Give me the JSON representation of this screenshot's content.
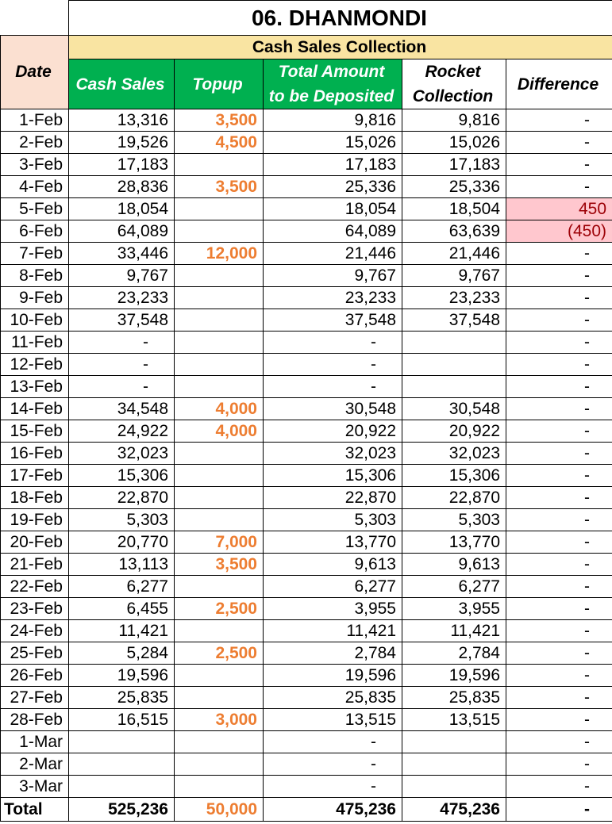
{
  "sheet": {
    "title": "06. DHANMONDI",
    "band_label": "Cash Sales Collection",
    "headers": {
      "date": "Date",
      "cash_sales": "Cash Sales",
      "topup": "Topup",
      "total_line1": "Total Amount",
      "total_line2": "to be Deposited",
      "rocket_line1": "Rocket",
      "rocket_line2": "Collection",
      "difference": "Difference"
    },
    "colors": {
      "header_green": "#00b050",
      "band_yellow": "#f9e4a2",
      "date_header_peach": "#fbe0d1",
      "topup_orange": "#ed7d31",
      "diff_highlight_bg": "#ffc7ce",
      "diff_highlight_text": "#9c0006"
    },
    "rows": [
      {
        "date": "1-Feb",
        "cash": "13,316",
        "topup": "3,500",
        "total": "9,816",
        "rocket": "9,816",
        "diff": "-"
      },
      {
        "date": "2-Feb",
        "cash": "19,526",
        "topup": "4,500",
        "total": "15,026",
        "rocket": "15,026",
        "diff": "-"
      },
      {
        "date": "3-Feb",
        "cash": "17,183",
        "topup": "",
        "total": "17,183",
        "rocket": "17,183",
        "diff": "-"
      },
      {
        "date": "4-Feb",
        "cash": "28,836",
        "topup": "3,500",
        "total": "25,336",
        "rocket": "25,336",
        "diff": "-"
      },
      {
        "date": "5-Feb",
        "cash": "18,054",
        "topup": "",
        "total": "18,054",
        "rocket": "18,504",
        "diff": "450",
        "diff_highlight": true
      },
      {
        "date": "6-Feb",
        "cash": "64,089",
        "topup": "",
        "total": "64,089",
        "rocket": "63,639",
        "diff": "(450)",
        "diff_highlight": true
      },
      {
        "date": "7-Feb",
        "cash": "33,446",
        "topup": "12,000",
        "total": "21,446",
        "rocket": "21,446",
        "diff": "-"
      },
      {
        "date": "8-Feb",
        "cash": "9,767",
        "topup": "",
        "total": "9,767",
        "rocket": "9,767",
        "diff": "-"
      },
      {
        "date": "9-Feb",
        "cash": "23,233",
        "topup": "",
        "total": "23,233",
        "rocket": "23,233",
        "diff": "-"
      },
      {
        "date": "10-Feb",
        "cash": "37,548",
        "topup": "",
        "total": "37,548",
        "rocket": "37,548",
        "diff": "-"
      },
      {
        "date": "11-Feb",
        "cash": "-",
        "topup": "",
        "total": "-",
        "rocket": "",
        "diff": "-"
      },
      {
        "date": "12-Feb",
        "cash": "-",
        "topup": "",
        "total": "-",
        "rocket": "",
        "diff": "-"
      },
      {
        "date": "13-Feb",
        "cash": "-",
        "topup": "",
        "total": "-",
        "rocket": "",
        "diff": "-"
      },
      {
        "date": "14-Feb",
        "cash": "34,548",
        "topup": "4,000",
        "total": "30,548",
        "rocket": "30,548",
        "diff": "-"
      },
      {
        "date": "15-Feb",
        "cash": "24,922",
        "topup": "4,000",
        "total": "20,922",
        "rocket": "20,922",
        "diff": "-"
      },
      {
        "date": "16-Feb",
        "cash": "32,023",
        "topup": "",
        "total": "32,023",
        "rocket": "32,023",
        "diff": "-"
      },
      {
        "date": "17-Feb",
        "cash": "15,306",
        "topup": "",
        "total": "15,306",
        "rocket": "15,306",
        "diff": "-"
      },
      {
        "date": "18-Feb",
        "cash": "22,870",
        "topup": "",
        "total": "22,870",
        "rocket": "22,870",
        "diff": "-"
      },
      {
        "date": "19-Feb",
        "cash": "5,303",
        "topup": "",
        "total": "5,303",
        "rocket": "5,303",
        "diff": "-"
      },
      {
        "date": "20-Feb",
        "cash": "20,770",
        "topup": "7,000",
        "total": "13,770",
        "rocket": "13,770",
        "diff": "-"
      },
      {
        "date": "21-Feb",
        "cash": "13,113",
        "topup": "3,500",
        "total": "9,613",
        "rocket": "9,613",
        "diff": "-"
      },
      {
        "date": "22-Feb",
        "cash": "6,277",
        "topup": "",
        "total": "6,277",
        "rocket": "6,277",
        "diff": "-"
      },
      {
        "date": "23-Feb",
        "cash": "6,455",
        "topup": "2,500",
        "total": "3,955",
        "rocket": "3,955",
        "diff": "-"
      },
      {
        "date": "24-Feb",
        "cash": "11,421",
        "topup": "",
        "total": "11,421",
        "rocket": "11,421",
        "diff": "-"
      },
      {
        "date": "25-Feb",
        "cash": "5,284",
        "topup": "2,500",
        "total": "2,784",
        "rocket": "2,784",
        "diff": "-"
      },
      {
        "date": "26-Feb",
        "cash": "19,596",
        "topup": "",
        "total": "19,596",
        "rocket": "19,596",
        "diff": "-"
      },
      {
        "date": "27-Feb",
        "cash": "25,835",
        "topup": "",
        "total": "25,835",
        "rocket": "25,835",
        "diff": "-"
      },
      {
        "date": "28-Feb",
        "cash": "16,515",
        "topup": "3,000",
        "total": "13,515",
        "rocket": "13,515",
        "diff": "-"
      },
      {
        "date": "1-Mar",
        "cash": "",
        "topup": "",
        "total": "-",
        "rocket": "",
        "diff": "-"
      },
      {
        "date": "2-Mar",
        "cash": "",
        "topup": "",
        "total": "-",
        "rocket": "",
        "diff": "-"
      },
      {
        "date": "3-Mar",
        "cash": "",
        "topup": "",
        "total": "-",
        "rocket": "",
        "diff": "-"
      }
    ],
    "total": {
      "label": "Total",
      "cash": "525,236",
      "topup": "50,000",
      "total": "475,236",
      "rocket": "475,236",
      "diff": "-"
    }
  }
}
